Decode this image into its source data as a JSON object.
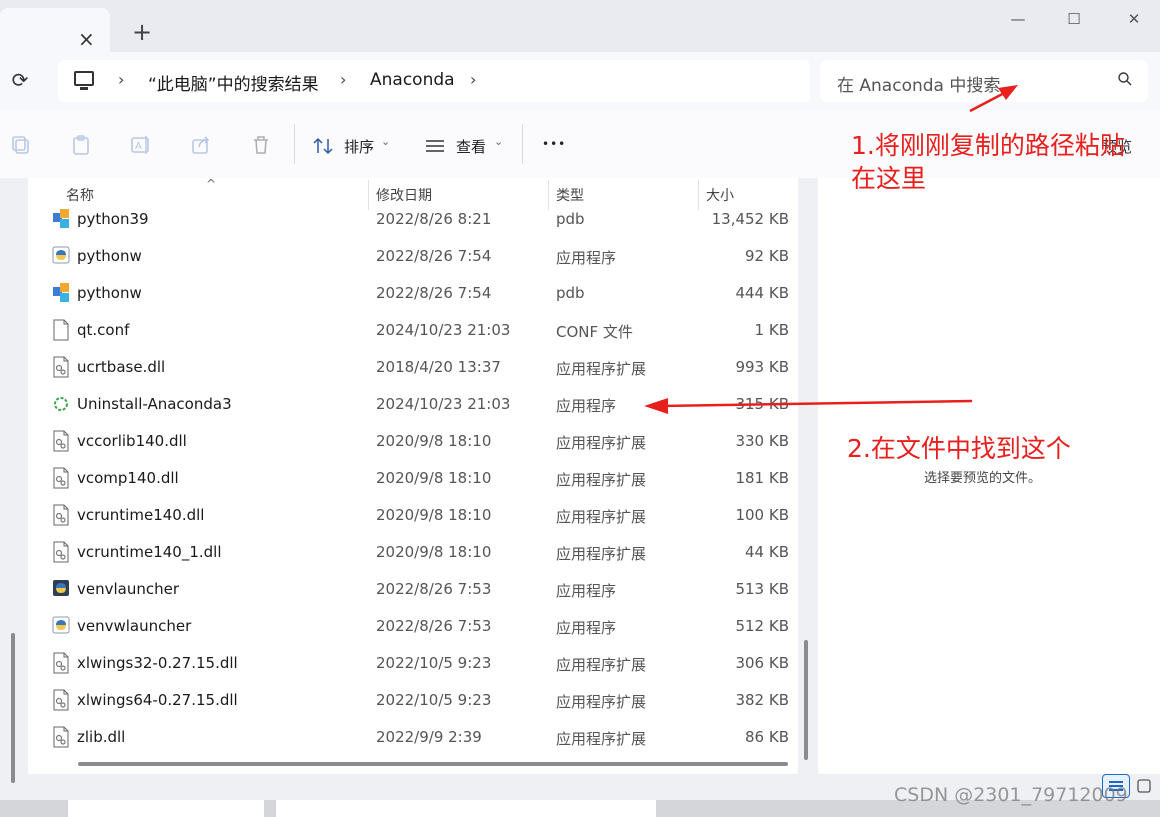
{
  "window": {
    "tab_close_glyph": "×",
    "new_tab_glyph": "+",
    "minimize_glyph": "—",
    "maximize_glyph": "☐",
    "close_glyph": "✕"
  },
  "address": {
    "refresh_glyph": "⟳",
    "separator": "›",
    "crumbs": [
      "“此电脑”中的搜索结果",
      "Anaconda"
    ],
    "search_placeholder": "在 Anaconda 中搜索"
  },
  "toolbar": {
    "sort_label": "排序",
    "view_label": "查看",
    "more_glyph": "•••",
    "chevron": "⌄",
    "preview_label": "预览"
  },
  "columns": {
    "name": "名称",
    "date": "修改日期",
    "type": "类型",
    "size": "大小",
    "sort_caret": "^"
  },
  "files": [
    {
      "name": "python39",
      "date": "2022/8/26 8:21",
      "type": "pdb",
      "size": "13,452 KB",
      "icon": "pdb"
    },
    {
      "name": "pythonw",
      "date": "2022/8/26 7:54",
      "type": "应用程序",
      "size": "92 KB",
      "icon": "python-exe"
    },
    {
      "name": "pythonw",
      "date": "2022/8/26 7:54",
      "type": "pdb",
      "size": "444 KB",
      "icon": "pdb"
    },
    {
      "name": "qt.conf",
      "date": "2024/10/23 21:03",
      "type": "CONF 文件",
      "size": "1 KB",
      "icon": "file"
    },
    {
      "name": "ucrtbase.dll",
      "date": "2018/4/20 13:37",
      "type": "应用程序扩展",
      "size": "993 KB",
      "icon": "dll"
    },
    {
      "name": "Uninstall-Anaconda3",
      "date": "2024/10/23 21:03",
      "type": "应用程序",
      "size": "315 KB",
      "icon": "anaconda"
    },
    {
      "name": "vccorlib140.dll",
      "date": "2020/9/8 18:10",
      "type": "应用程序扩展",
      "size": "330 KB",
      "icon": "dll"
    },
    {
      "name": "vcomp140.dll",
      "date": "2020/9/8 18:10",
      "type": "应用程序扩展",
      "size": "181 KB",
      "icon": "dll"
    },
    {
      "name": "vcruntime140.dll",
      "date": "2020/9/8 18:10",
      "type": "应用程序扩展",
      "size": "100 KB",
      "icon": "dll"
    },
    {
      "name": "vcruntime140_1.dll",
      "date": "2020/9/8 18:10",
      "type": "应用程序扩展",
      "size": "44 KB",
      "icon": "dll"
    },
    {
      "name": "venvlauncher",
      "date": "2022/8/26 7:53",
      "type": "应用程序",
      "size": "513 KB",
      "icon": "python-dark"
    },
    {
      "name": "venvwlauncher",
      "date": "2022/8/26 7:53",
      "type": "应用程序",
      "size": "512 KB",
      "icon": "python-exe"
    },
    {
      "name": "xlwings32-0.27.15.dll",
      "date": "2022/10/5 9:23",
      "type": "应用程序扩展",
      "size": "306 KB",
      "icon": "dll"
    },
    {
      "name": "xlwings64-0.27.15.dll",
      "date": "2022/10/5 9:23",
      "type": "应用程序扩展",
      "size": "382 KB",
      "icon": "dll"
    },
    {
      "name": "zlib.dll",
      "date": "2022/9/9 2:39",
      "type": "应用程序扩展",
      "size": "86 KB",
      "icon": "dll"
    }
  ],
  "preview": {
    "empty_text": "选择要预览的文件。"
  },
  "annotations": {
    "step1_line1": "1.将刚刚复制的路径粘贴",
    "step1_line2": "在这里",
    "step2": "2.在文件中找到这个",
    "color": "#e8201d"
  },
  "watermark": "CSDN @2301_79712009"
}
